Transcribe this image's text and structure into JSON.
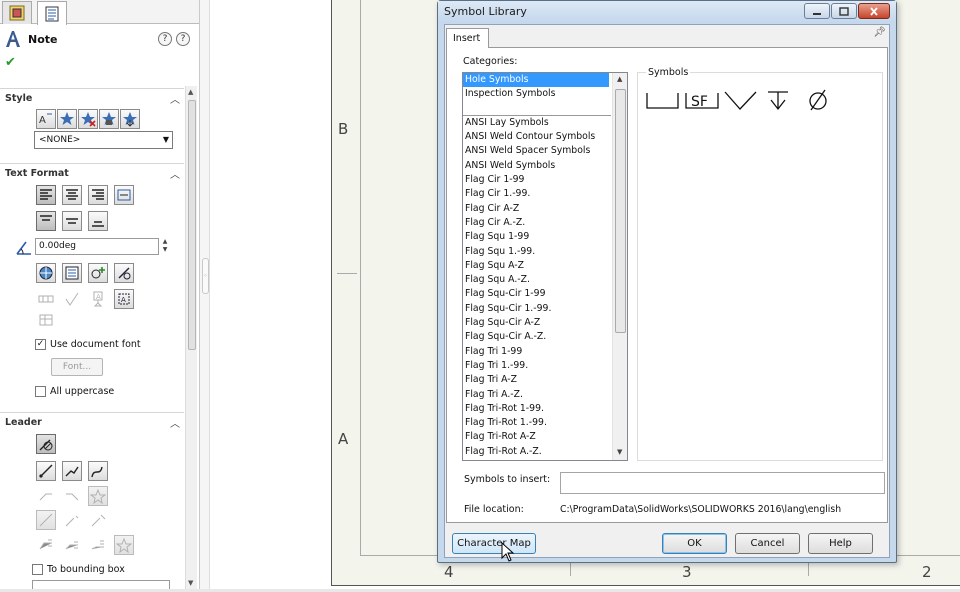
{
  "property_manager": {
    "title": "Note",
    "sections": {
      "style": "Style",
      "text_format": "Text Format",
      "leader": "Leader"
    },
    "style_combo_value": "<NONE>",
    "angle_value": "0.00deg",
    "use_document_font_label": "Use document font",
    "use_document_font_checked": true,
    "font_button_label": "Font...",
    "all_uppercase_label": "All uppercase",
    "all_uppercase_checked": false,
    "to_bounding_box_label": "To bounding box",
    "to_bounding_box_checked": false
  },
  "sheet": {
    "zone_letters": [
      "B",
      "A"
    ],
    "zone_numbers": [
      "4",
      "3",
      "2"
    ]
  },
  "dialog": {
    "title": "Symbol Library",
    "tab_label": "Insert",
    "categories_label": "Categories:",
    "categories": [
      "Hole Symbols",
      "Inspection Symbols",
      "",
      "ANSI Lay Symbols",
      "ANSI Weld Contour Symbols",
      "ANSI Weld Spacer Symbols",
      "ANSI Weld Symbols",
      "Flag Cir 1-99",
      "Flag Cir 1.-99.",
      "Flag Cir A-Z",
      "Flag Cir A.-Z.",
      "Flag Squ 1-99",
      "Flag Squ 1.-99.",
      "Flag Squ A-Z",
      "Flag Squ A.-Z.",
      "Flag Squ-Cir 1-99",
      "Flag Squ-Cir 1.-99.",
      "Flag Squ-Cir A-Z",
      "Flag Squ-Cir A.-Z.",
      "Flag Tri 1-99",
      "Flag Tri 1.-99.",
      "Flag Tri A-Z",
      "Flag Tri A.-Z.",
      "Flag Tri-Rot 1-99.",
      "Flag Tri-Rot 1.-99.",
      "Flag Tri-Rot A-Z",
      "Flag Tri-Rot A.-Z."
    ],
    "selected_category": "Hole Symbols",
    "symbols_label": "Symbols",
    "symbols": [
      "counterbore",
      "SF",
      "countersink",
      "depth",
      "diameter"
    ],
    "symbols_to_insert_label": "Symbols to insert:",
    "symbols_to_insert_value": "",
    "file_location_label": "File location:",
    "file_location_value": "C:\\ProgramData\\SolidWorks\\SOLIDWORKS 2016\\lang\\english",
    "buttons": {
      "character_map": "Character Map",
      "ok": "OK",
      "cancel": "Cancel",
      "help": "Help"
    }
  },
  "colors": {
    "selection": "#3399ff",
    "dialog_frame": "#c5d8ec",
    "close_button": "#c7442b",
    "check_green": "#2b9a2b"
  }
}
